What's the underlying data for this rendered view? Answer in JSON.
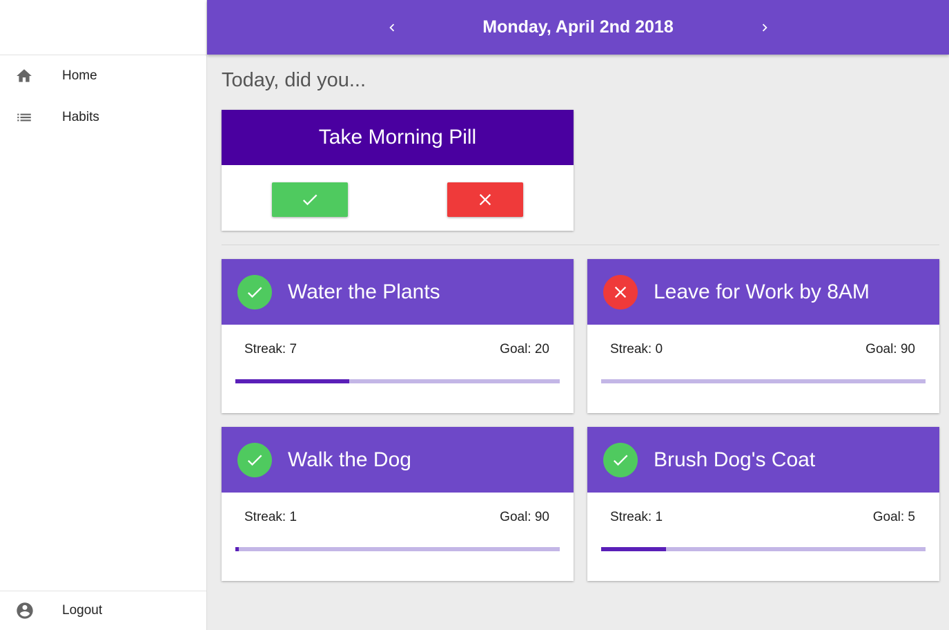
{
  "sidebar": {
    "items": [
      {
        "label": "Home",
        "icon": "home-icon"
      },
      {
        "label": "Habits",
        "icon": "list-icon"
      }
    ],
    "logout": {
      "label": "Logout",
      "icon": "account-circle-icon"
    }
  },
  "header": {
    "date": "Monday, April 2nd 2018"
  },
  "main": {
    "prompt": "Today, did you...",
    "pending": {
      "title": "Take Morning Pill"
    },
    "habits": [
      {
        "name": "Water the Plants",
        "status": "done",
        "streak_label": "Streak: 7",
        "goal_label": "Goal: 20",
        "streak": 7,
        "goal": 20
      },
      {
        "name": "Leave for Work by 8AM",
        "status": "fail",
        "streak_label": "Streak: 0",
        "goal_label": "Goal: 90",
        "streak": 0,
        "goal": 90
      },
      {
        "name": "Walk the Dog",
        "status": "done",
        "streak_label": "Streak: 1",
        "goal_label": "Goal: 90",
        "streak": 1,
        "goal": 90
      },
      {
        "name": "Brush Dog's Coat",
        "status": "done",
        "streak_label": "Streak: 1",
        "goal_label": "Goal: 5",
        "streak": 1,
        "goal": 5
      }
    ]
  },
  "colors": {
    "header": "#6e48c8",
    "pending_header": "#4a00a0",
    "success": "#4fca5f",
    "failure": "#ef3a3a",
    "progress_fill": "#5a1fb8",
    "progress_track": "#c3b6e6"
  }
}
